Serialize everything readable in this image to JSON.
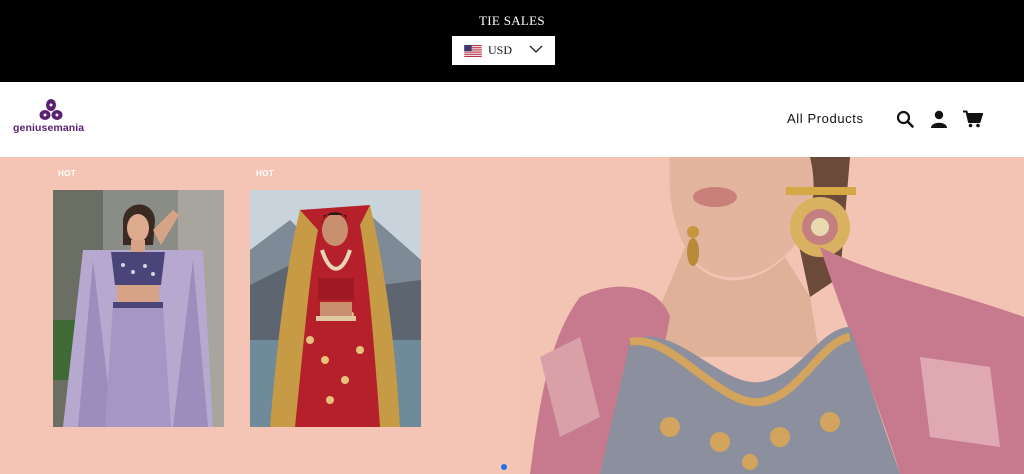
{
  "announcement": "TIE SALES",
  "currency": {
    "code": "USD",
    "flag_icon": "us-flag-icon"
  },
  "header": {
    "brand": "geniusemania",
    "nav_link": "All Products",
    "icons": [
      "search-icon",
      "account-icon",
      "cart-icon"
    ]
  },
  "hero": {
    "products": [
      {
        "badge": "HOT",
        "image": "lavender-crop-top-cape-outfit"
      },
      {
        "badge": "HOT",
        "image": "red-bandhani-saree-with-dupatta"
      }
    ],
    "slide_image": "model-grey-embroidered-blouse-pink-jacket",
    "slides_total": 1,
    "slide_active": 1
  },
  "colors": {
    "topbar": "#000000",
    "hero_bg": "#f4c5b4",
    "brand": "#5a1f6e",
    "dot_active": "#1a73e8"
  }
}
